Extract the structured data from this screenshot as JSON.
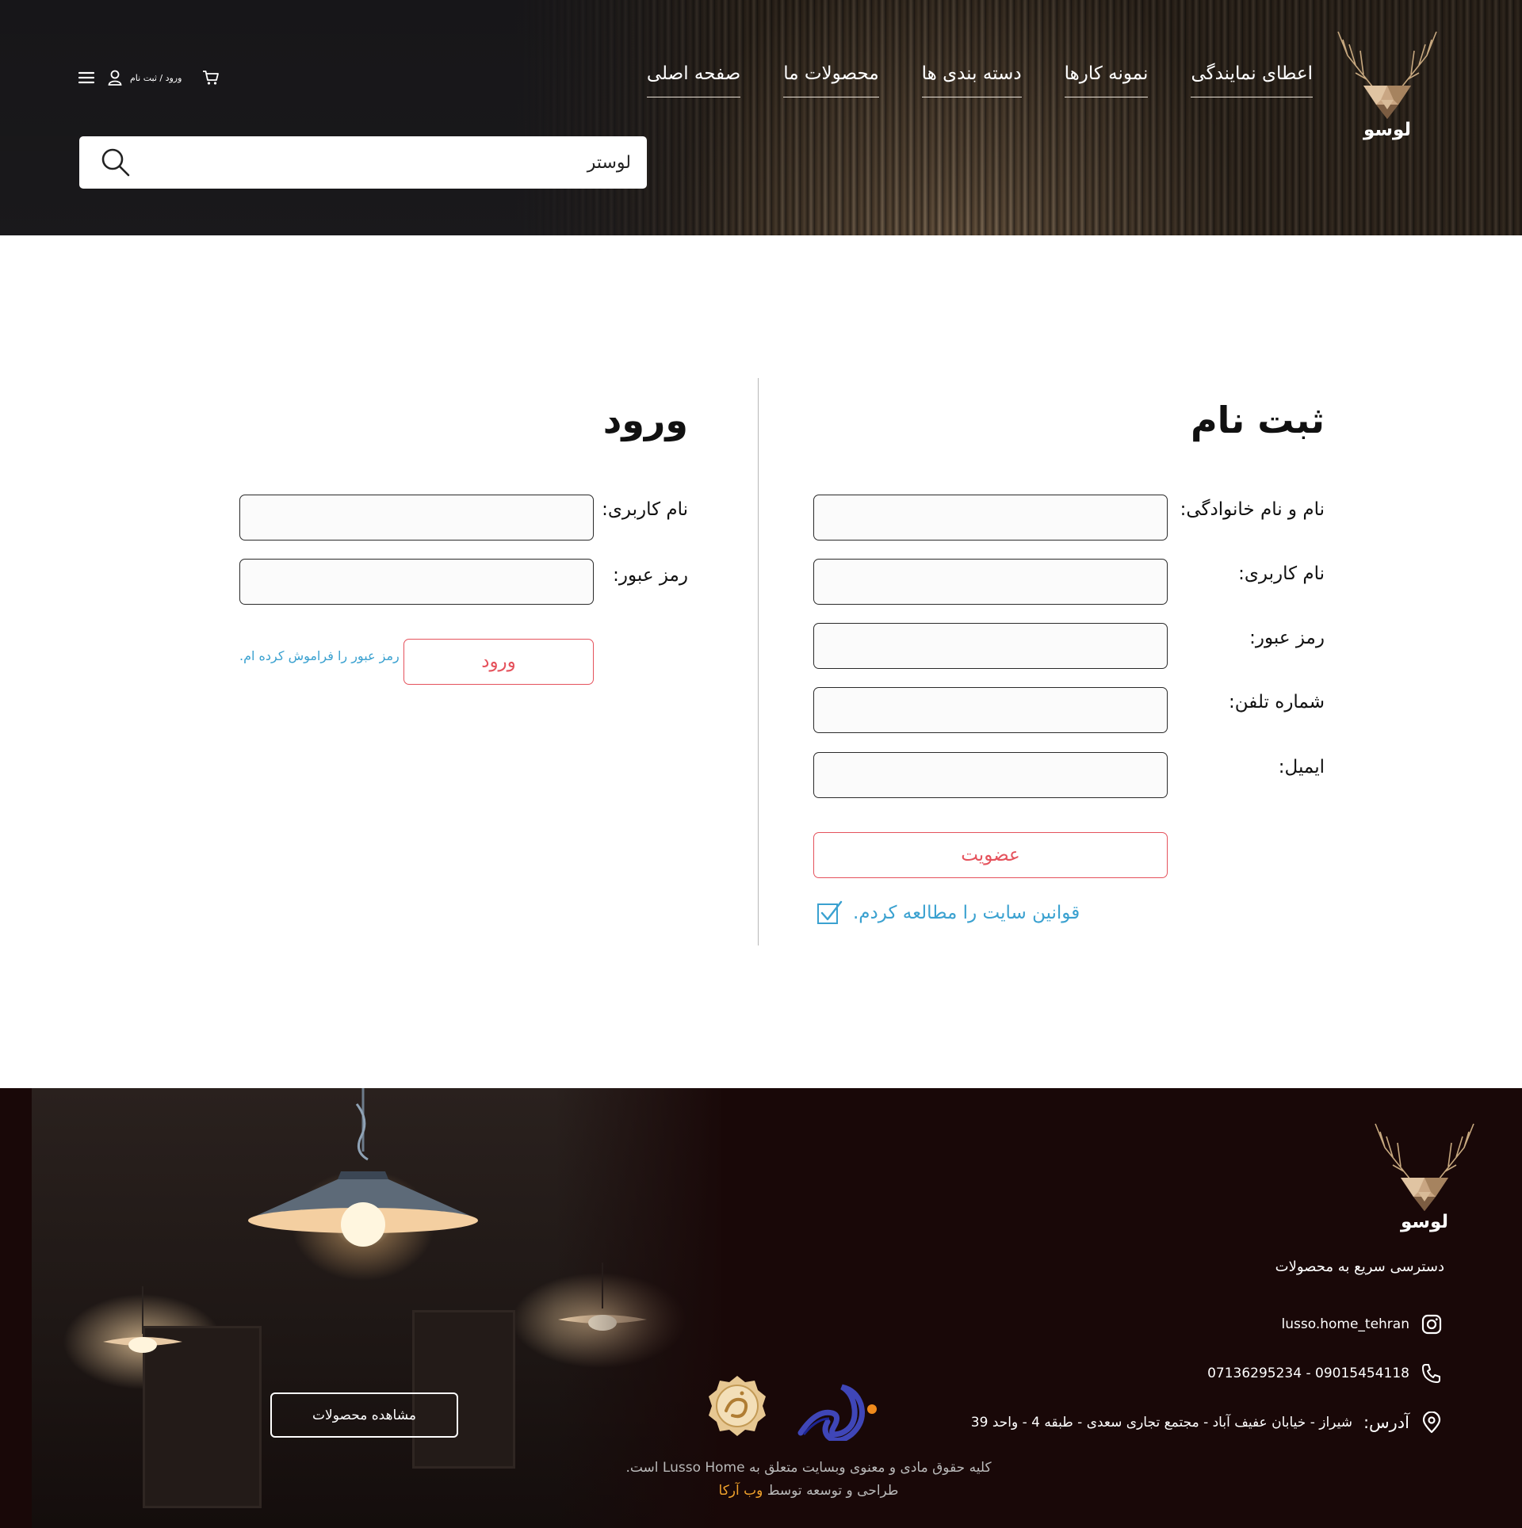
{
  "header": {
    "logo_text": "لوسو",
    "nav": [
      {
        "label": "صفحه اصلی"
      },
      {
        "label": "محصولات ما"
      },
      {
        "label": "دسته بندی ها"
      },
      {
        "label": "نمونه کارها"
      },
      {
        "label": "اعطای نمایندگی"
      }
    ],
    "auth_link": "ورود / ثبت نام",
    "search": {
      "value": "لوستر",
      "placeholder": ""
    }
  },
  "register": {
    "title": "ثبت نام",
    "fields": [
      {
        "label": "نام و نام خانوادگی:",
        "value": ""
      },
      {
        "label": "نام کاربری:",
        "value": ""
      },
      {
        "label": "رمز عبور:",
        "value": ""
      },
      {
        "label": "شماره تلفن:",
        "value": ""
      },
      {
        "label": "ایمیل:",
        "value": ""
      }
    ],
    "submit_label": "عضویت",
    "terms_label": "قوانین سایت را مطالعه کردم.",
    "terms_checked": true
  },
  "login": {
    "title": "ورود",
    "fields": [
      {
        "label": "نام کاربری:",
        "value": ""
      },
      {
        "label": "رمز عبور:",
        "value": ""
      }
    ],
    "submit_label": "ورود",
    "forgot_label": "رمز عبور را فراموش کرده ام."
  },
  "footer": {
    "logo_text": "لوسو",
    "quick_access": "دسترسی سریع به محصولات",
    "instagram": "lusso.home_tehran",
    "phone": "07136295234 - 09015454118",
    "address_label": "آدرس:",
    "address": "شیراز - خیابان عفیف آباد - مجتمع تجاری سعدی - طبقه 4 - واحد 39",
    "view_products_label": "مشاهده محصولات",
    "copyright": "کلیه حقوق مادی و معنوی وبسایت متعلق به Lusso Home است.",
    "credit_prefix": "طراحی و توسعه توسط",
    "credit_brand": "وب آرکا"
  },
  "colors": {
    "accent_red": "#e5525c",
    "link_blue": "#3aa1d0",
    "footer_bg": "#190808",
    "credit_orange": "#f0a12b"
  },
  "icons": [
    "menu-icon",
    "user-icon",
    "cart-icon",
    "search-icon",
    "check-icon",
    "instagram-icon",
    "phone-icon",
    "location-icon"
  ]
}
